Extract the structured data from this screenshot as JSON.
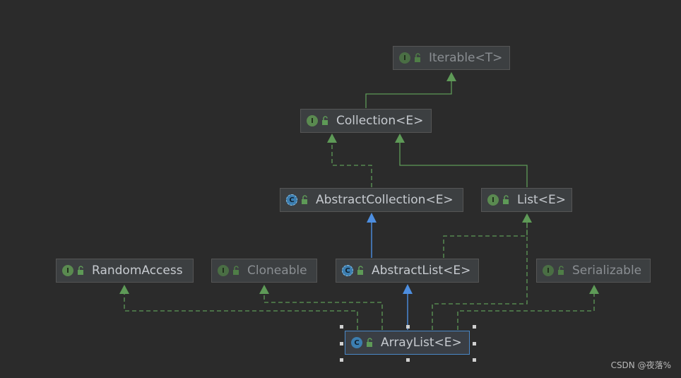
{
  "diagram": {
    "nodes": {
      "iterable": {
        "label": "Iterable<T>",
        "kind": "interface"
      },
      "collection": {
        "label": "Collection<E>",
        "kind": "interface"
      },
      "abstract_collection": {
        "label": "AbstractCollection<E>",
        "kind": "abstract-class"
      },
      "list": {
        "label": "List<E>",
        "kind": "interface"
      },
      "random_access": {
        "label": "RandomAccess",
        "kind": "interface"
      },
      "cloneable": {
        "label": "Cloneable",
        "kind": "interface"
      },
      "abstract_list": {
        "label": "AbstractList<E>",
        "kind": "abstract-class"
      },
      "serializable": {
        "label": "Serializable",
        "kind": "interface"
      },
      "array_list": {
        "label": "ArrayList<E>",
        "kind": "class"
      }
    },
    "edges": [
      {
        "from": "collection",
        "to": "iterable",
        "type": "extends"
      },
      {
        "from": "abstract_collection",
        "to": "collection",
        "type": "implements"
      },
      {
        "from": "list",
        "to": "collection",
        "type": "extends"
      },
      {
        "from": "abstract_list",
        "to": "abstract_collection",
        "type": "extends-class"
      },
      {
        "from": "abstract_list",
        "to": "list",
        "type": "implements"
      },
      {
        "from": "array_list",
        "to": "abstract_list",
        "type": "extends-class"
      },
      {
        "from": "array_list",
        "to": "random_access",
        "type": "implements"
      },
      {
        "from": "array_list",
        "to": "cloneable",
        "type": "implements"
      },
      {
        "from": "array_list",
        "to": "list",
        "type": "implements"
      },
      {
        "from": "array_list",
        "to": "serializable",
        "type": "implements"
      }
    ],
    "selected": "array_list"
  },
  "colors": {
    "background": "#2b2b2b",
    "node_fill": "#3c3f41",
    "interface_edge": "#5e9a57",
    "class_edge": "#4d8ee0",
    "selection_border": "#4a88c7"
  },
  "icons": {
    "interface": "interface-icon",
    "abstract_class": "abstract-class-icon",
    "class": "class-icon",
    "visibility": "public-lock-icon"
  },
  "watermark": "CSDN @夜落%"
}
